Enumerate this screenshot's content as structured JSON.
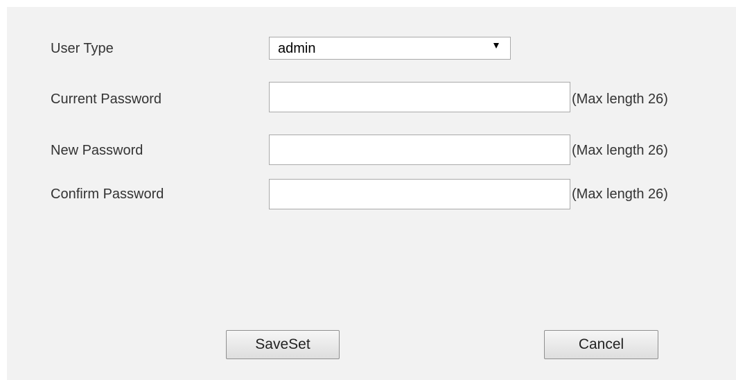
{
  "form": {
    "user_type": {
      "label": "User Type",
      "selected": "admin",
      "arrow_icon": "triangle-down-icon"
    },
    "current_password": {
      "label": "Current Password",
      "value": "",
      "hint": "(Max length 26)"
    },
    "new_password": {
      "label": "New Password",
      "value": "",
      "hint": "(Max length 26)"
    },
    "confirm_password": {
      "label": "Confirm Password",
      "value": "",
      "hint": "(Max length 26)"
    }
  },
  "buttons": {
    "save_label": "SaveSet",
    "cancel_label": "Cancel"
  },
  "colors": {
    "panel_background": "#f2f2f2",
    "field_border": "#a9a9a9"
  }
}
